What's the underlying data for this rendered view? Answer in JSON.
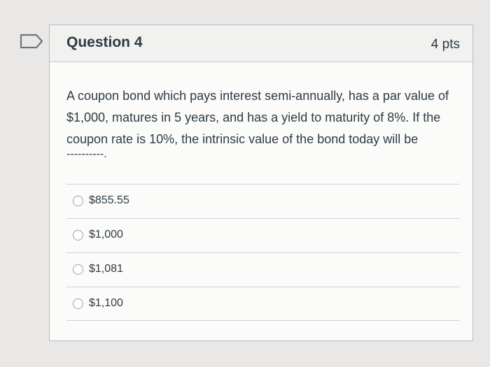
{
  "question": {
    "title": "Question 4",
    "points": "4 pts",
    "text": "A coupon bond which pays interest semi-annually, has a par value of $1,000, matures in 5 years, and has a yield to maturity of 8%. If the coupon rate is 10%, the intrinsic value of the bond today will be",
    "blank": "----------.",
    "answers": [
      {
        "label": "$855.55"
      },
      {
        "label": "$1,000"
      },
      {
        "label": "$1,081"
      },
      {
        "label": "$1,100"
      }
    ]
  },
  "icons": {
    "flag": "flag-question-icon"
  },
  "colors": {
    "flag_outline": "#6b7780",
    "text": "#2d3b45",
    "header_background": "#f1f1ef"
  }
}
